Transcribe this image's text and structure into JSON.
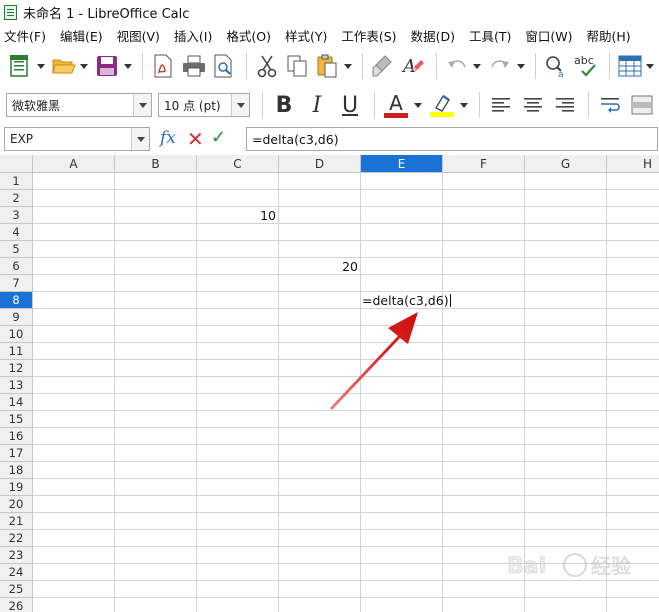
{
  "window": {
    "title": "未命名 1 - LibreOffice Calc"
  },
  "menubar": {
    "items": [
      "文件(F)",
      "编辑(E)",
      "视图(V)",
      "插入(I)",
      "格式(O)",
      "样式(Y)",
      "工作表(S)",
      "数据(D)",
      "工具(T)",
      "窗口(W)",
      "帮助(H)"
    ]
  },
  "toolbar": {
    "icons": [
      "new-document",
      "open-folder",
      "save",
      "export-pdf",
      "print",
      "print-preview",
      "cut",
      "copy",
      "paste",
      "clone-formatting",
      "clear-formatting",
      "undo",
      "redo",
      "find-replace",
      "spellcheck",
      "insert-table"
    ]
  },
  "format": {
    "font_name": "微软雅黑",
    "font_size": "10 点 (pt)",
    "bold": "B",
    "italic": "I",
    "underline": "U",
    "font_color_letter": "A",
    "font_color": "#c9211e",
    "highlight_color": "#ffff00"
  },
  "formula_bar": {
    "name_box": "EXP",
    "fx": "fx",
    "formula": "=delta(c3,d6)"
  },
  "sheet": {
    "columns": [
      "A",
      "B",
      "C",
      "D",
      "E",
      "F",
      "G",
      "H"
    ],
    "active_column": "E",
    "rows": [
      "1",
      "2",
      "3",
      "4",
      "5",
      "6",
      "7",
      "8",
      "9",
      "10",
      "11",
      "12",
      "13",
      "14",
      "15",
      "16",
      "17",
      "18",
      "19",
      "20",
      "21",
      "22",
      "23",
      "24",
      "25",
      "26"
    ],
    "active_row": "8",
    "cells": {
      "c3": "10",
      "d6": "20",
      "e8": "=delta(c3,d6)"
    }
  },
  "watermark": {
    "text": "Bai 经验"
  }
}
